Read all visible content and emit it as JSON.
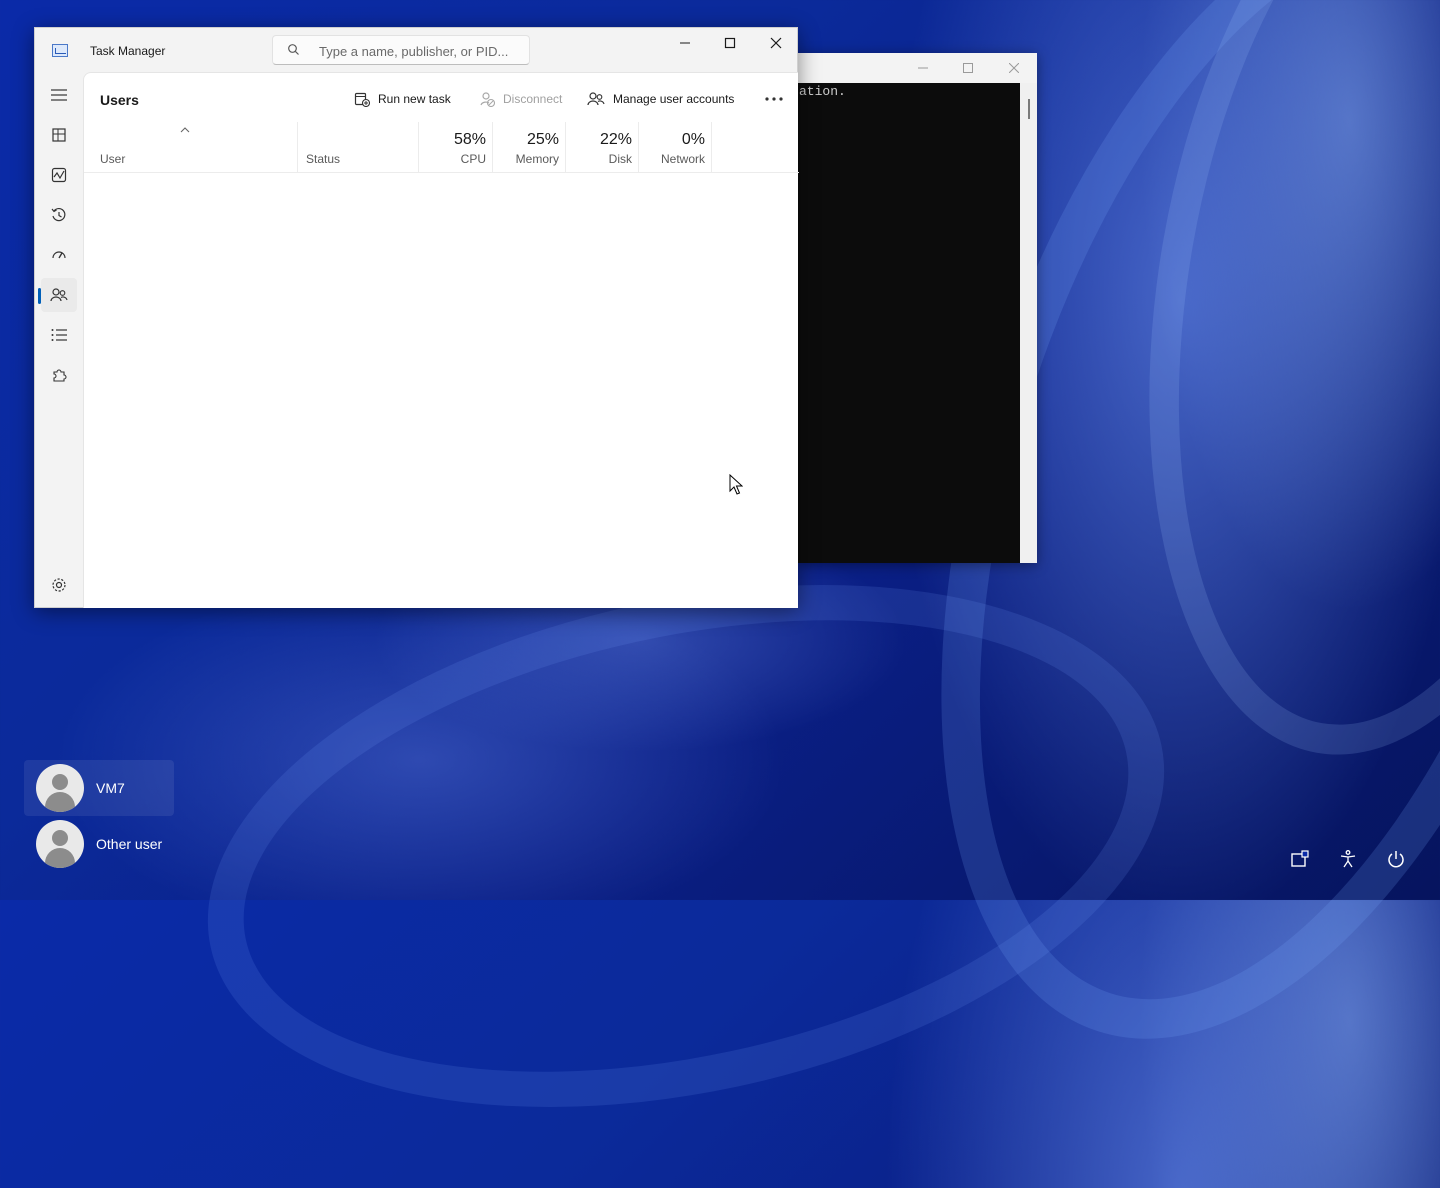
{
  "console": {
    "text": "ation."
  },
  "task_manager": {
    "title": "Task Manager",
    "search_placeholder": "Type a name, publisher, or PID...",
    "nav_items": [
      "Processes",
      "Performance",
      "App history",
      "Startup apps",
      "Users",
      "Details",
      "Services"
    ],
    "nav_active": "Users",
    "page_title": "Users",
    "toolbar": {
      "run_new_task": "Run new task",
      "disconnect": "Disconnect",
      "manage_user_accounts": "Manage user accounts"
    },
    "columns": {
      "user": "User",
      "status": "Status",
      "cpu": {
        "value": "58%",
        "label": "CPU"
      },
      "memory": {
        "value": "25%",
        "label": "Memory"
      },
      "disk": {
        "value": "22%",
        "label": "Disk"
      },
      "network": {
        "value": "0%",
        "label": "Network"
      }
    }
  },
  "lock_screen": {
    "users": [
      {
        "name": "VM7",
        "selected": true
      },
      {
        "name": "Other user",
        "selected": false
      }
    ],
    "system_buttons": [
      "network-icon",
      "accessibility-icon",
      "power-icon"
    ]
  },
  "colors": {
    "accent": "#005fb8",
    "desktop": "#0a2aa8"
  }
}
